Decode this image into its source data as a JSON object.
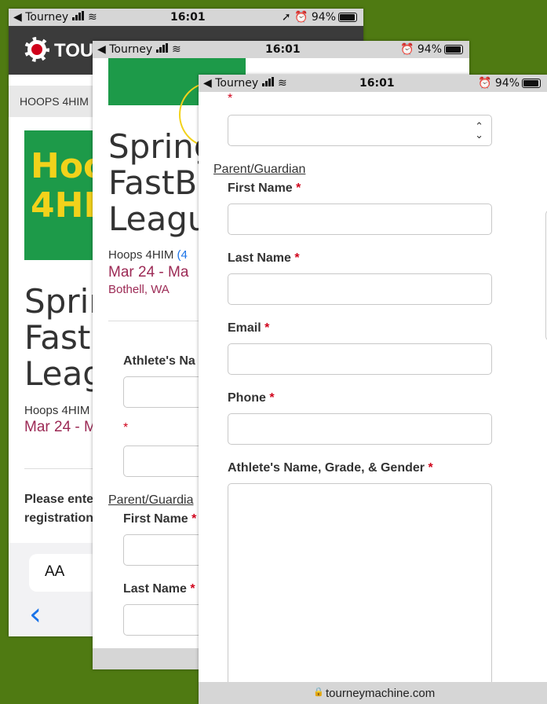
{
  "status": {
    "carrier": "Tourney",
    "time": "16:01",
    "battery": "94%"
  },
  "back_shot": {
    "header_logo_text": "TOUR",
    "breadcrumb": "HOOPS 4HIM",
    "logo_line1": "Hoo",
    "logo_line2": "4HI",
    "event_title_lines": [
      "Sprin",
      "Fastb",
      "Leag"
    ],
    "organizer": "Hoops 4HIM",
    "dates": "Mar 24 - M",
    "prompt_line1": "Please ente",
    "prompt_line2": "registration",
    "text_size_button": "AA",
    "back_chevron": "‹"
  },
  "middle_shot": {
    "event_title_lines": [
      "Spring",
      "FastB",
      "Leagu"
    ],
    "organizer": "Hoops 4HIM",
    "organizer_suffix": "(4",
    "dates": "Mar 24 - Ma",
    "location": "Bothell, WA",
    "athlete_label": "Athlete's Na",
    "asterisk": "*",
    "parent_heading": "Parent/Guardia",
    "first_name_label": "First Name",
    "last_name_label": "Last Name"
  },
  "front_shot": {
    "asterisk": "*",
    "parent_heading": "Parent/Guardian",
    "fields": [
      {
        "label": "First Name"
      },
      {
        "label": "Last Name"
      },
      {
        "label": "Email"
      },
      {
        "label": "Phone"
      },
      {
        "label": "Athlete's Name, Grade, & Gender"
      }
    ],
    "url": "tourneymachine.com"
  },
  "colors": {
    "background": "#4f7a12",
    "accent_maroon": "#9c2a55",
    "required": "#d0021b",
    "logo_green": "#1d9a49",
    "logo_yellow": "#f2d21b"
  }
}
